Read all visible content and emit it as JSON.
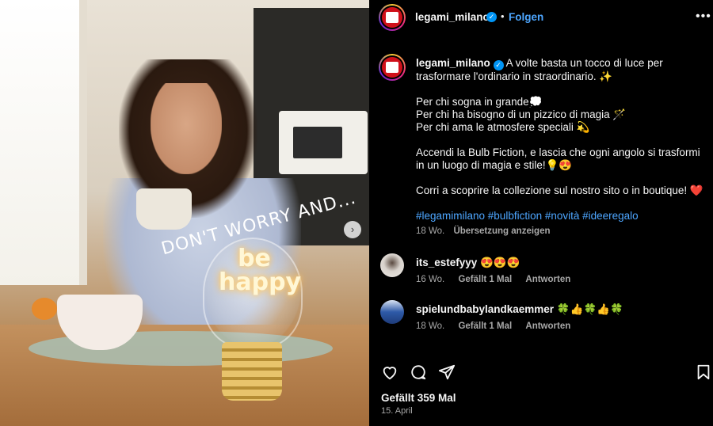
{
  "post": {
    "image_overlay_text": "DON'T WORRY AND...",
    "bulb_text_line1": "be",
    "bulb_text_line2": "happy",
    "next_icon": "chevron-right-icon"
  },
  "header": {
    "username": "legami_milano",
    "separator": "•",
    "follow_label": "Folgen",
    "more_label": "•••",
    "avatar_logo_text": "LEGAMI"
  },
  "caption": {
    "username": "legami_milano",
    "line1": "A volte basta un tocco di luce per trasformare l'ordinario in straordinario. ✨",
    "line2": "Per chi sogna in grande💭",
    "line3": "Per chi ha bisogno di un pizzico di magia 🪄",
    "line4": "Per chi ama le atmosfere speciali 💫",
    "line5": "Accendi la Bulb Fiction, e lascia che ogni angolo si trasformi in un luogo di magia e stile!💡😍",
    "line6": "Corri a scoprire la collezione sul nostro sito o in boutique! ❤️",
    "hashtags": "#legamimilano #bulbfiction #novità #ideeregalo",
    "age": "18 Wo.",
    "translate_label": "Übersetzung anzeigen"
  },
  "comments": [
    {
      "username": "its_estefyyy",
      "text": "😍😍😍",
      "age": "16 Wo.",
      "likes": "Gefällt 1 Mal",
      "reply_label": "Antworten"
    },
    {
      "username": "spielundbabylandkaemmer",
      "text": "🍀👍🍀👍🍀",
      "age": "18 Wo.",
      "likes": "Gefällt 1 Mal",
      "reply_label": "Antworten"
    }
  ],
  "footer": {
    "likes": "Gefällt 359 Mal",
    "date": "15. April"
  },
  "colors": {
    "accent": "#4da6ff",
    "background": "#000000",
    "verified": "#0095f6",
    "brand_red": "#d0101a"
  }
}
